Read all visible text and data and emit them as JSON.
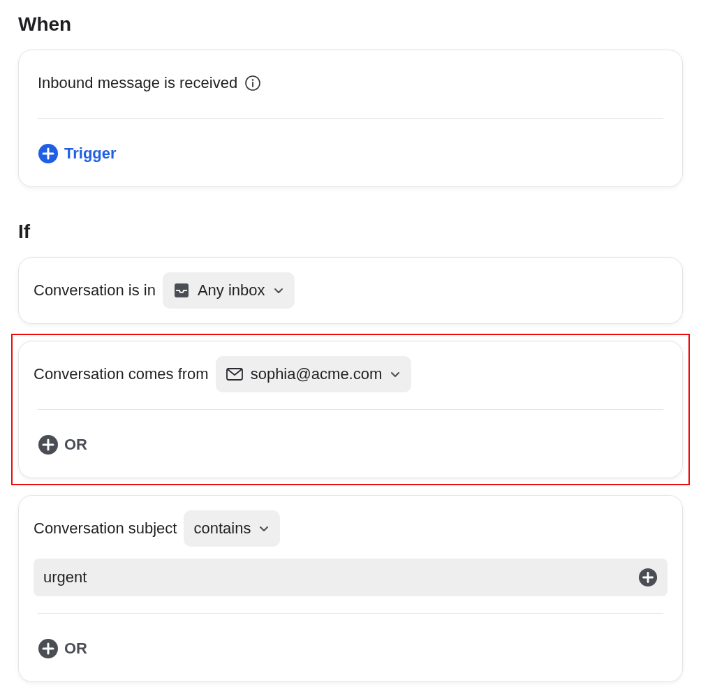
{
  "when": {
    "heading": "When",
    "trigger_text": "Inbound message is received",
    "add_button": "Trigger"
  },
  "if": {
    "heading": "If",
    "conditions": [
      {
        "kind": "inbox",
        "label": "Conversation is in",
        "dropdown": "Any inbox",
        "highlighted": false
      },
      {
        "kind": "sender",
        "label": "Conversation comes from",
        "dropdown": "sophia@acme.com",
        "or_button": "OR",
        "highlighted": true
      },
      {
        "kind": "subject",
        "label": "Conversation subject",
        "dropdown": "contains",
        "input_value": "urgent",
        "or_button": "OR",
        "highlighted": false
      }
    ]
  }
}
